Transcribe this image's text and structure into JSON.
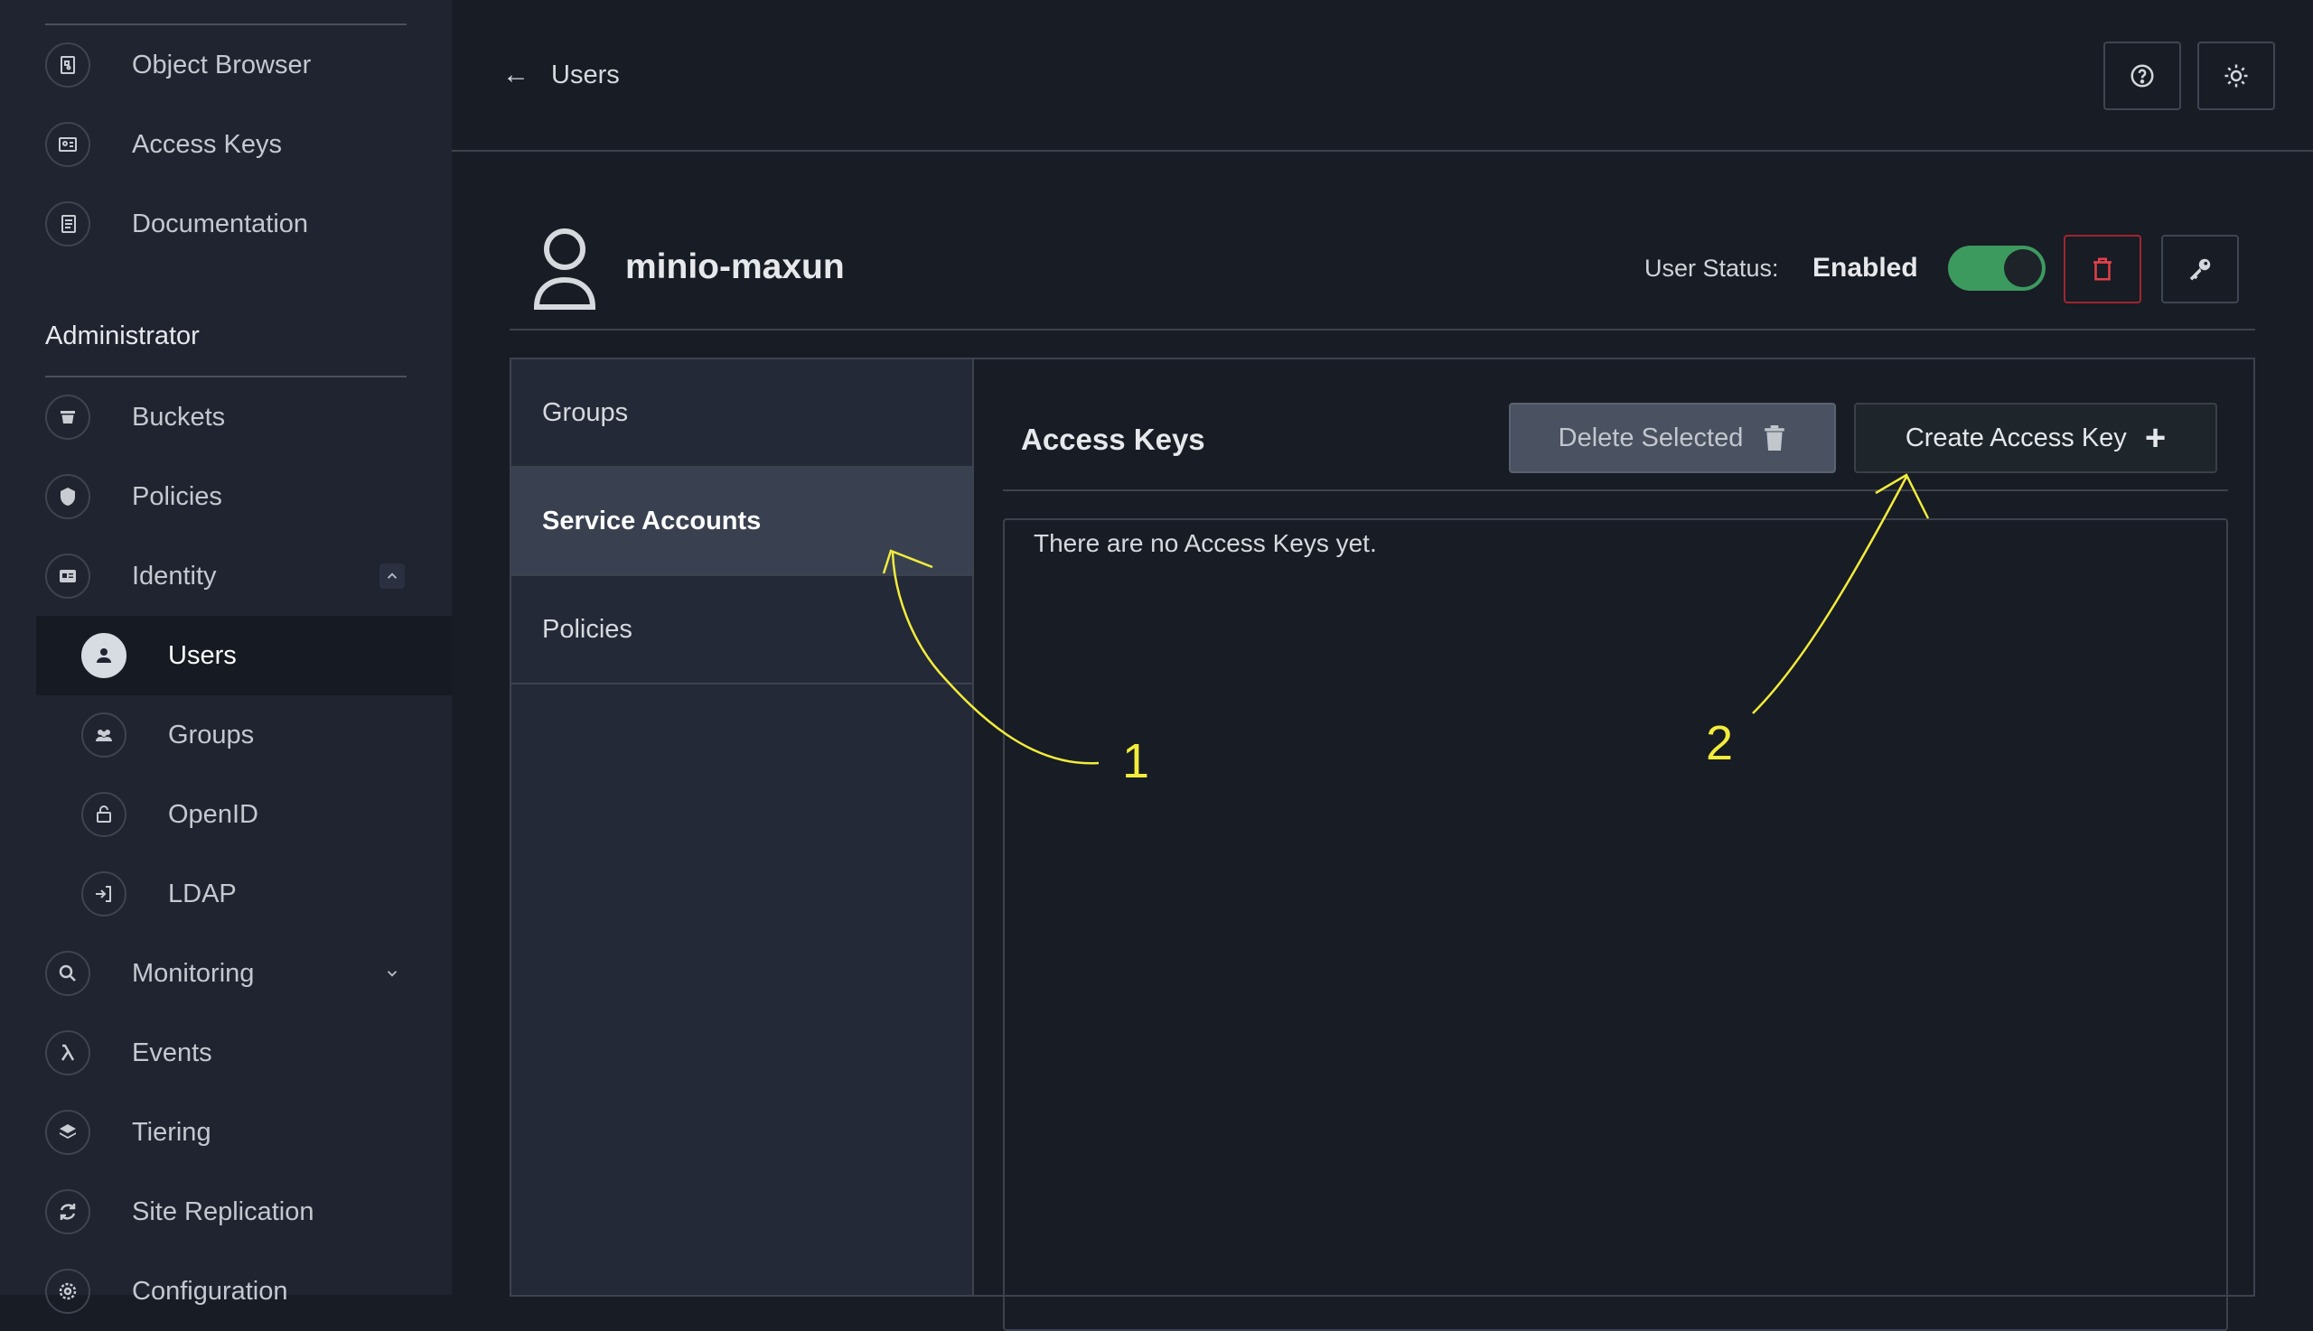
{
  "sidebar": {
    "items_top": [
      {
        "label": "Object Browser",
        "icon": "object-browser-icon"
      },
      {
        "label": "Access Keys",
        "icon": "access-keys-icon"
      },
      {
        "label": "Documentation",
        "icon": "documentation-icon"
      }
    ],
    "section_title": "Administrator",
    "items_admin": [
      {
        "label": "Buckets",
        "icon": "bucket-icon"
      },
      {
        "label": "Policies",
        "icon": "policy-icon"
      },
      {
        "label": "Identity",
        "icon": "identity-icon"
      }
    ],
    "identity_sub": [
      {
        "label": "Users",
        "icon": "user-icon",
        "active": true
      },
      {
        "label": "Groups",
        "icon": "groups-icon"
      },
      {
        "label": "OpenID",
        "icon": "openid-icon"
      },
      {
        "label": "LDAP",
        "icon": "ldap-icon"
      }
    ],
    "items_bottom": [
      {
        "label": "Monitoring",
        "icon": "monitoring-icon"
      },
      {
        "label": "Events",
        "icon": "lambda-icon"
      },
      {
        "label": "Tiering",
        "icon": "tiering-icon"
      },
      {
        "label": "Site Replication",
        "icon": "replication-icon"
      },
      {
        "label": "Configuration",
        "icon": "gear-icon"
      }
    ]
  },
  "topbar": {
    "back_label": "Users",
    "help_icon": "help-icon",
    "theme_icon": "sun-icon"
  },
  "user": {
    "name": "minio-maxun",
    "status_label": "User Status:",
    "status_value": "Enabled",
    "enabled": true
  },
  "tabs": [
    {
      "label": "Groups",
      "active": false
    },
    {
      "label": "Service Accounts",
      "active": true
    },
    {
      "label": "Policies",
      "active": false
    }
  ],
  "content": {
    "title": "Access Keys",
    "delete_selected_label": "Delete Selected",
    "create_label": "Create Access Key",
    "empty_message": "There are no Access Keys yet."
  },
  "annotations": {
    "marker_1": "1",
    "marker_2": "2",
    "color": "#f2ec3c"
  },
  "colors": {
    "background": "#181c24",
    "sidebar": "#1f2430",
    "toggle_on": "#3c9a5f",
    "danger": "#e0404a"
  }
}
